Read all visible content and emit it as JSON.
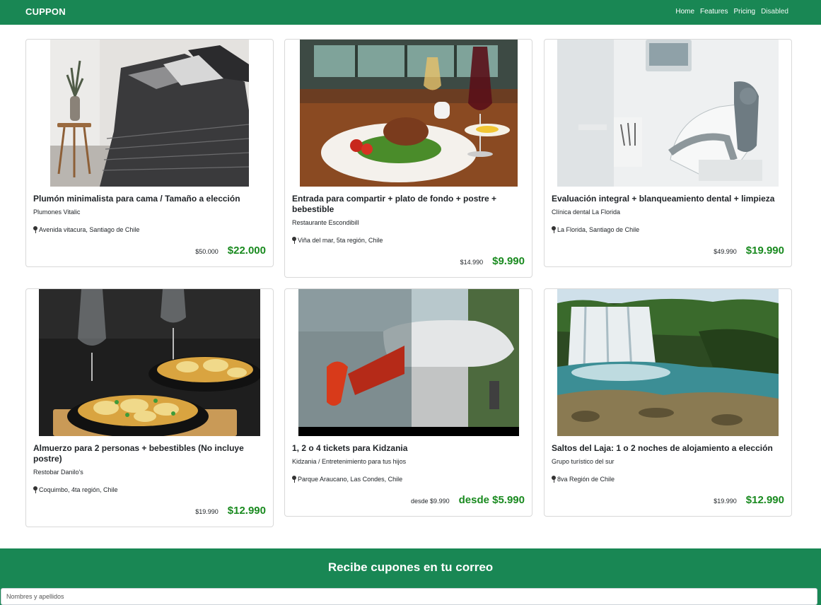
{
  "navbar": {
    "brand": "CUPPON",
    "links": [
      "Home",
      "Features",
      "Pricing",
      "Disabled"
    ],
    "color": "#198754"
  },
  "cards": [
    {
      "title": "Plumón minimalista para cama / Tamaño a elección",
      "merchant": "Plumones Vitalic",
      "location": "Avenida vitacura, Santiago de Chile",
      "old_price": "$50.000",
      "new_price": "$22.000",
      "image": "bedding-photo"
    },
    {
      "title": "Entrada para compartir + plato de fondo + postre + bebestible",
      "merchant": "Restaurante Escondibill",
      "location": "Viña del mar, 5ta región, Chile",
      "old_price": "$14.990",
      "new_price": "$9.990",
      "image": "restaurant-dish-photo"
    },
    {
      "title": "Evaluación integral + blanqueamiento dental + limpieza",
      "merchant": "Clínica dental La Florida",
      "location": "La Florida, Santiago de Chile",
      "old_price": "$49.990",
      "new_price": "$19.990",
      "image": "dental-chair-photo"
    },
    {
      "title": "Almuerzo para 2 personas + bebestibles (No incluye postre)",
      "merchant": "Restobar Danilo's",
      "location": "Coquimbo, 4ta región, Chile",
      "old_price": "$19.990",
      "new_price": "$12.990",
      "image": "food-pans-photo"
    },
    {
      "title": "1, 2 o 4 tickets para Kidzania",
      "merchant": "Kidzania / Entretenimiento para tus hijos",
      "location": "Parque Araucano, Las Condes, Chile",
      "old_price": "desde $9.990",
      "new_price": "desde $5.990",
      "image": "kidzania-photo"
    },
    {
      "title": "Saltos del Laja: 1 o 2 noches de alojamiento a elección",
      "merchant": "Grupo turístico del sur",
      "location": "8va Región de Chile",
      "old_price": "$19.990",
      "new_price": "$12.990",
      "image": "waterfall-photo"
    }
  ],
  "subscribe": {
    "heading": "Recibe cupones en tu correo",
    "name_placeholder": "Nombres y apellidos"
  },
  "colors": {
    "primary": "#198754",
    "price": "#198a1f"
  }
}
